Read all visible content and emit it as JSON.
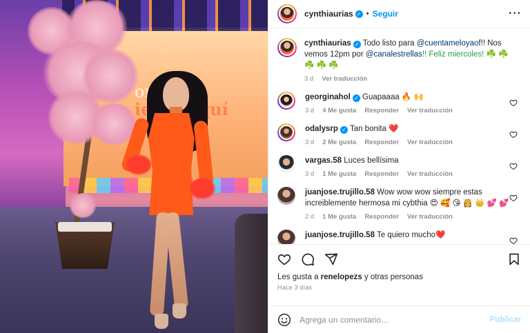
{
  "post": {
    "author": "cynthiaurias",
    "follow_label": "Seguir",
    "caption_text_1": "Todo listo para ",
    "caption_mention_1": "@cuentameloyaof",
    "caption_text_2": "!! Nos vemos 12pm por ",
    "caption_mention_2": "@canalestrellas",
    "caption_text_3": "!! Feliz miercoles! ☘️ ☘️ ☘️ ☘️ ☘️",
    "caption_time": "3 d",
    "caption_translate": "Ver traducción"
  },
  "photo": {
    "screen_line1": "ora aquí",
    "screen_line2": "ienta aquí"
  },
  "comments": [
    {
      "user": "georginahol",
      "verified": true,
      "text": "Guapaaaa 🔥 🙌",
      "time": "3 d",
      "likes": "4 Me gusta",
      "reply": "Responder",
      "translate": "Ver traducción"
    },
    {
      "user": "odalysrp",
      "verified": true,
      "text": "Tan bonita ❤️",
      "time": "3 d",
      "likes": "2 Me gusta",
      "reply": "Responder",
      "translate": "Ver traducción"
    },
    {
      "user": "vargas.58",
      "verified": false,
      "text": "Luces bellísima",
      "time": "3 d",
      "likes": "1 Me gusta",
      "reply": "Responder",
      "translate": "Ver traducción"
    },
    {
      "user": "juanjose.trujillo.58",
      "verified": false,
      "text": "Wow wow wow siempre estas increiblemente hermosa mi cybthia 😍 🥰 😘 👸 👑 💕 💕",
      "time": "2 d",
      "likes": "1 Me gusta",
      "reply": "Responder",
      "translate": "Ver traducción"
    },
    {
      "user": "juanjose.trujillo.58",
      "verified": false,
      "text": "Te quiero mucho❤️"
    }
  ],
  "actions": {
    "likes_prefix": "Les gusta a ",
    "likes_user": "renelopezs",
    "likes_suffix": " y otras personas",
    "posted_ago": "Hace 3 días"
  },
  "add_comment": {
    "placeholder": "Agrega un comentario...",
    "publish_label": "Publicar"
  },
  "icons": {
    "like": "heart-icon",
    "comment": "comment-icon",
    "share": "share-icon",
    "save": "bookmark-icon",
    "emoji": "emoji-icon",
    "more": "more-options-icon"
  },
  "colors": {
    "link": "#0095f6",
    "mention": "#00376b",
    "meta": "#8e8e8e",
    "publish_disabled": "#b2dffc"
  }
}
